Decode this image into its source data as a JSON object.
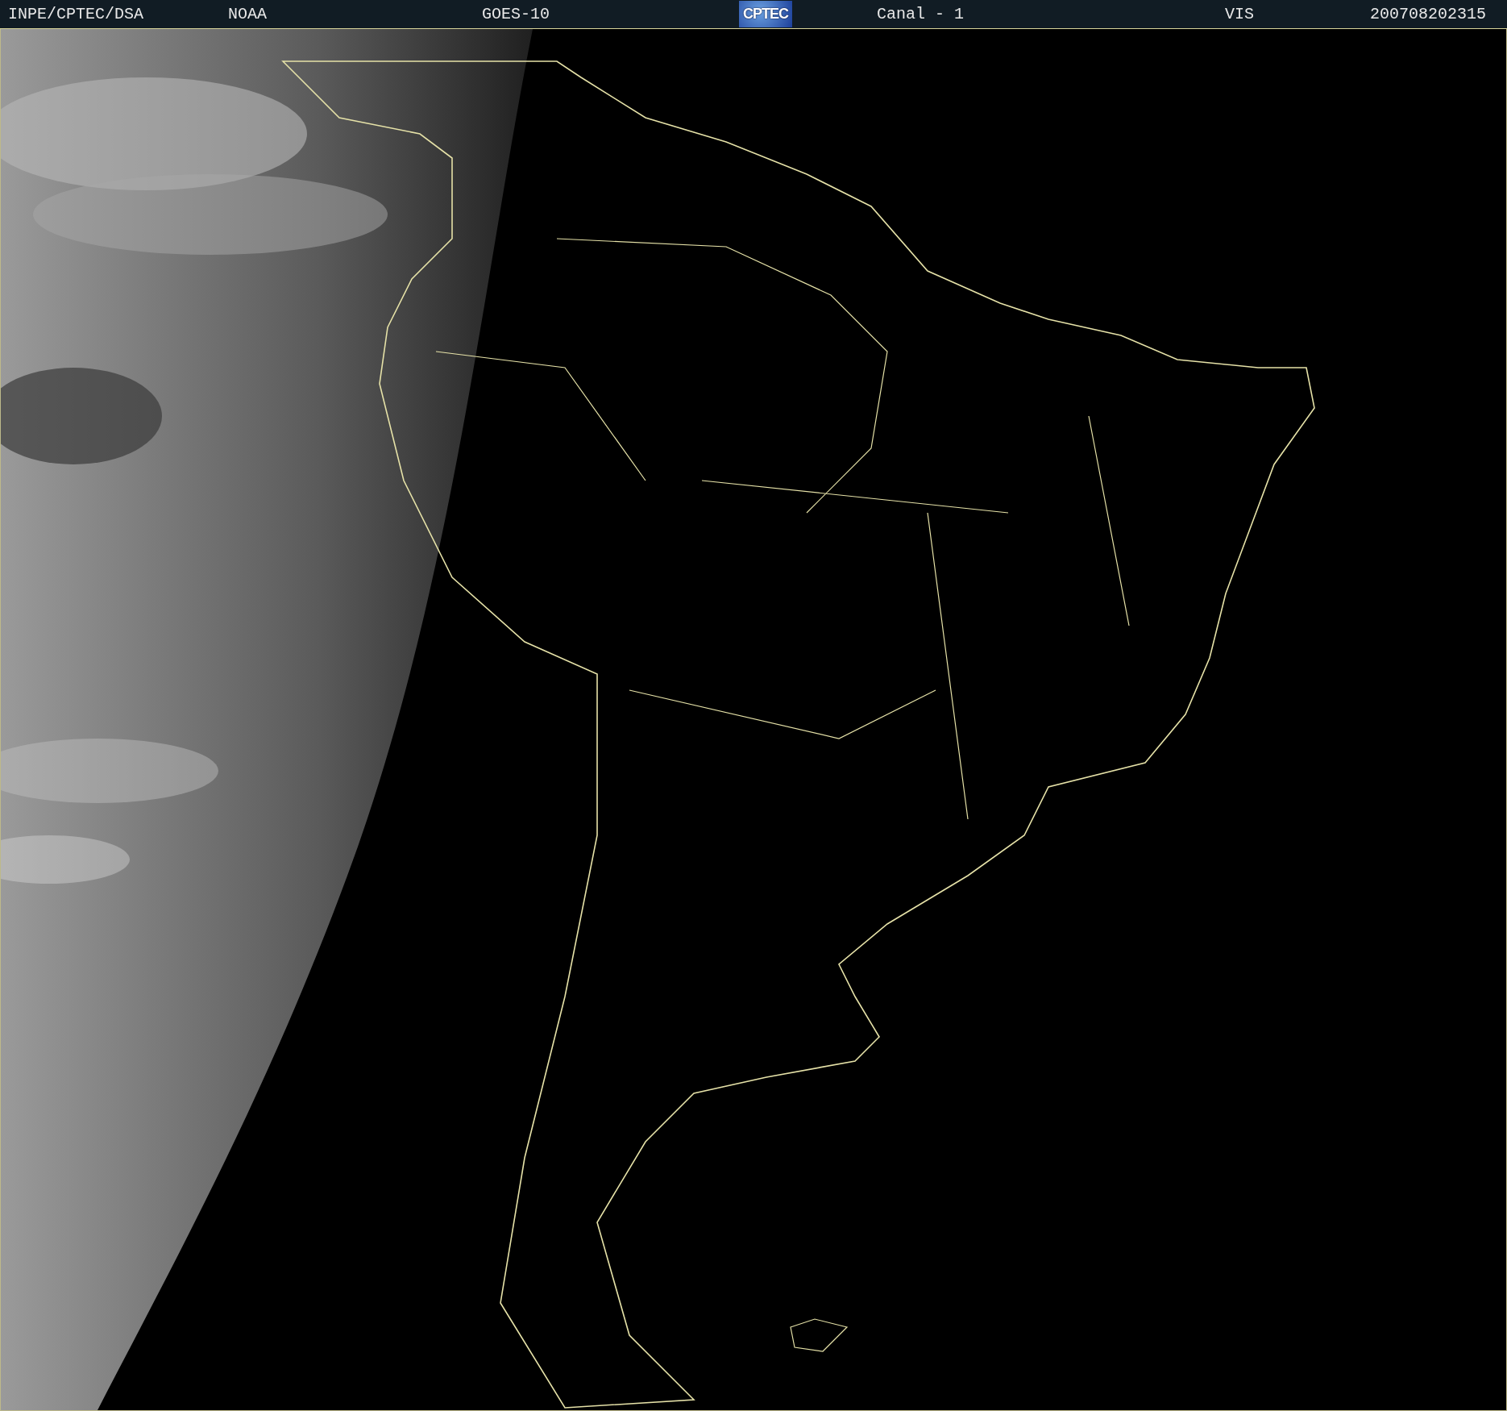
{
  "header": {
    "items": [
      {
        "kind": "text",
        "text": "INPE/CPTEC/DSA"
      },
      {
        "kind": "text",
        "text": "NOAA"
      },
      {
        "kind": "text",
        "text": "GOES-10"
      },
      {
        "kind": "logo",
        "text": "CPTEC"
      },
      {
        "kind": "text",
        "text": "Canal - 1"
      },
      {
        "kind": "text",
        "text": "VIS"
      },
      {
        "kind": "text",
        "text": "200708202315"
      }
    ]
  }
}
